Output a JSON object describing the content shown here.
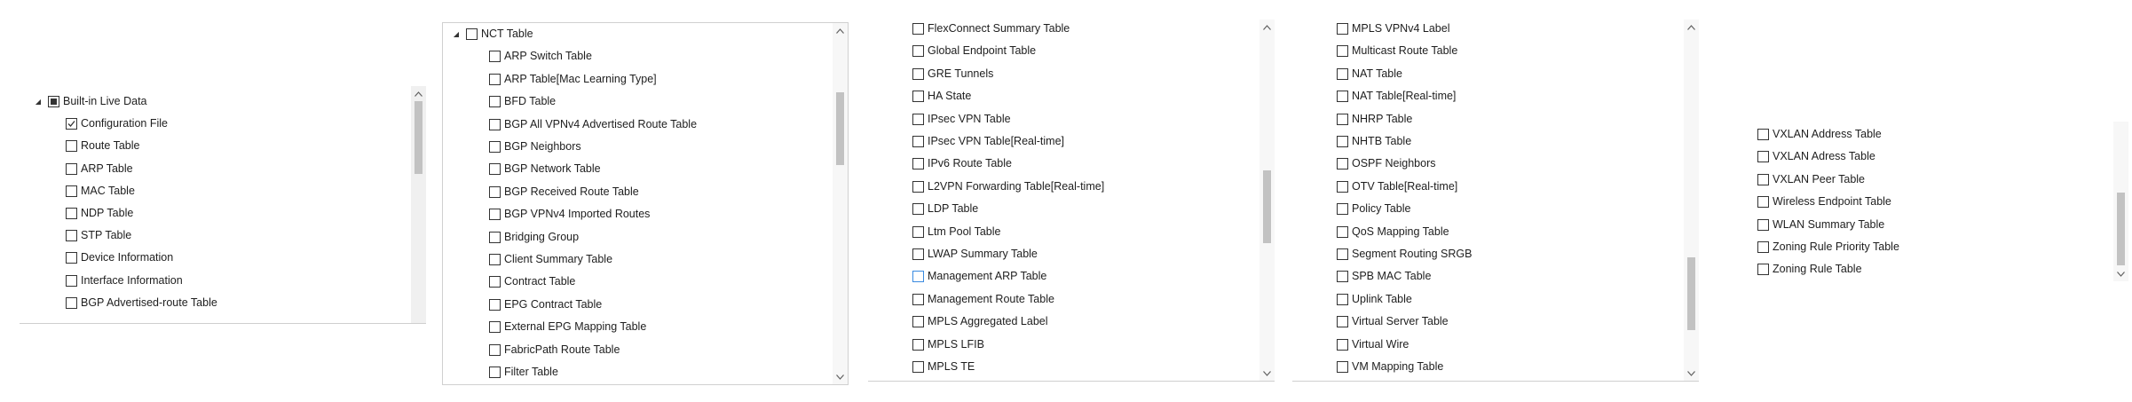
{
  "colors": {
    "background": "#ffffff",
    "text": "#1e1e1e",
    "checkbox_border": "#333333",
    "checkbox_hover_border": "#3a8be0",
    "scrollbar_track": "#f0f0f0",
    "scrollbar_thumb": "#c2c2c2"
  },
  "panels": [
    {
      "rows": [
        {
          "label": "Built-in Live Data",
          "checkbox": "partial",
          "expander": "expanded"
        },
        {
          "label": "Configuration File",
          "checkbox": "checked"
        },
        {
          "label": "Route Table",
          "checkbox": "unchecked"
        },
        {
          "label": "ARP Table",
          "checkbox": "unchecked"
        },
        {
          "label": "MAC Table",
          "checkbox": "unchecked"
        },
        {
          "label": "NDP Table",
          "checkbox": "unchecked"
        },
        {
          "label": "STP Table",
          "checkbox": "unchecked"
        },
        {
          "label": "Device Information",
          "checkbox": "unchecked"
        },
        {
          "label": "Interface Information",
          "checkbox": "unchecked"
        },
        {
          "label": "BGP Advertised-route Table",
          "checkbox": "unchecked"
        }
      ]
    },
    {
      "rows": [
        {
          "label": "NCT Table",
          "checkbox": "unchecked",
          "expander": "expanded"
        },
        {
          "label": "ARP Switch Table",
          "checkbox": "unchecked"
        },
        {
          "label": "ARP Table[Mac Learning Type]",
          "checkbox": "unchecked"
        },
        {
          "label": "BFD Table",
          "checkbox": "unchecked"
        },
        {
          "label": "BGP All VPNv4 Advertised Route Table",
          "checkbox": "unchecked"
        },
        {
          "label": "BGP Neighbors",
          "checkbox": "unchecked"
        },
        {
          "label": "BGP Network Table",
          "checkbox": "unchecked"
        },
        {
          "label": "BGP Received Route Table",
          "checkbox": "unchecked"
        },
        {
          "label": "BGP VPNv4 Imported Routes",
          "checkbox": "unchecked"
        },
        {
          "label": "Bridging Group",
          "checkbox": "unchecked"
        },
        {
          "label": "Client Summary Table",
          "checkbox": "unchecked"
        },
        {
          "label": "Contract Table",
          "checkbox": "unchecked"
        },
        {
          "label": "EPG Contract Table",
          "checkbox": "unchecked"
        },
        {
          "label": "External EPG Mapping Table",
          "checkbox": "unchecked"
        },
        {
          "label": "FabricPath Route Table",
          "checkbox": "unchecked"
        },
        {
          "label": "Filter Table",
          "checkbox": "unchecked"
        }
      ]
    },
    {
      "rows": [
        {
          "label": "FlexConnect Summary Table",
          "checkbox": "unchecked"
        },
        {
          "label": "Global Endpoint Table",
          "checkbox": "unchecked"
        },
        {
          "label": "GRE Tunnels",
          "checkbox": "unchecked"
        },
        {
          "label": "HA State",
          "checkbox": "unchecked"
        },
        {
          "label": "IPsec VPN Table",
          "checkbox": "unchecked"
        },
        {
          "label": "IPsec VPN Table[Real-time]",
          "checkbox": "unchecked"
        },
        {
          "label": "IPv6 Route Table",
          "checkbox": "unchecked"
        },
        {
          "label": "L2VPN Forwarding Table[Real-time]",
          "checkbox": "unchecked"
        },
        {
          "label": "LDP Table",
          "checkbox": "unchecked"
        },
        {
          "label": "Ltm Pool Table",
          "checkbox": "unchecked"
        },
        {
          "label": "LWAP Summary Table",
          "checkbox": "unchecked"
        },
        {
          "label": "Management ARP Table",
          "checkbox": "unchecked",
          "hover": true
        },
        {
          "label": "Management Route Table",
          "checkbox": "unchecked"
        },
        {
          "label": "MPLS Aggregated Label",
          "checkbox": "unchecked"
        },
        {
          "label": "MPLS LFIB",
          "checkbox": "unchecked"
        },
        {
          "label": "MPLS TE",
          "checkbox": "unchecked"
        }
      ]
    },
    {
      "rows": [
        {
          "label": "MPLS VPNv4 Label",
          "checkbox": "unchecked"
        },
        {
          "label": "Multicast Route Table",
          "checkbox": "unchecked"
        },
        {
          "label": "NAT Table",
          "checkbox": "unchecked"
        },
        {
          "label": "NAT Table[Real-time]",
          "checkbox": "unchecked"
        },
        {
          "label": "NHRP Table",
          "checkbox": "unchecked"
        },
        {
          "label": "NHTB Table",
          "checkbox": "unchecked"
        },
        {
          "label": "OSPF Neighbors",
          "checkbox": "unchecked"
        },
        {
          "label": "OTV Table[Real-time]",
          "checkbox": "unchecked"
        },
        {
          "label": "Policy Table",
          "checkbox": "unchecked"
        },
        {
          "label": "QoS Mapping Table",
          "checkbox": "unchecked"
        },
        {
          "label": "Segment Routing SRGB",
          "checkbox": "unchecked"
        },
        {
          "label": "SPB MAC Table",
          "checkbox": "unchecked"
        },
        {
          "label": "Uplink Table",
          "checkbox": "unchecked"
        },
        {
          "label": "Virtual Server Table",
          "checkbox": "unchecked"
        },
        {
          "label": "Virtual Wire",
          "checkbox": "unchecked"
        },
        {
          "label": "VM Mapping Table",
          "checkbox": "unchecked"
        }
      ]
    },
    {
      "rows": [
        {
          "label": "VXLAN Address Table",
          "checkbox": "unchecked"
        },
        {
          "label": "VXLAN Adress Table",
          "checkbox": "unchecked"
        },
        {
          "label": "VXLAN Peer Table",
          "checkbox": "unchecked"
        },
        {
          "label": "Wireless Endpoint Table",
          "checkbox": "unchecked"
        },
        {
          "label": "WLAN Summary Table",
          "checkbox": "unchecked"
        },
        {
          "label": "Zoning Rule Priority Table",
          "checkbox": "unchecked"
        },
        {
          "label": "Zoning Rule Table",
          "checkbox": "unchecked"
        }
      ]
    }
  ]
}
